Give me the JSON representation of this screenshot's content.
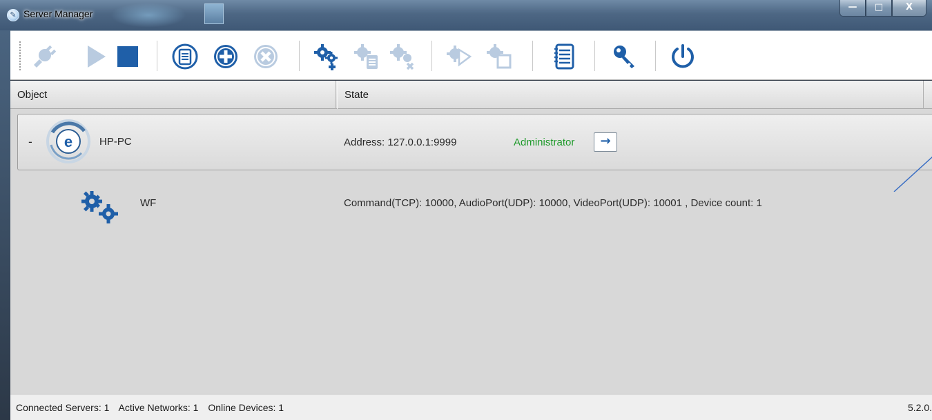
{
  "window": {
    "title": "Server Manager",
    "caption_buttons": {
      "minimize": "—",
      "maximize": "□",
      "close": "X"
    }
  },
  "toolbar": {
    "buttons": [
      {
        "name": "connect",
        "icon": "plug-connect-icon",
        "enabled": false
      },
      {
        "name": "start",
        "icon": "play-icon",
        "enabled": false
      },
      {
        "name": "stop",
        "icon": "stop-icon",
        "enabled": true
      },
      {
        "name": "server-properties",
        "icon": "circle-list-icon",
        "enabled": true
      },
      {
        "name": "add-server",
        "icon": "circle-plus-icon",
        "enabled": true
      },
      {
        "name": "remove-server",
        "icon": "circle-x-icon",
        "enabled": false
      },
      {
        "name": "add-network",
        "icon": "gears-plus-icon",
        "enabled": true
      },
      {
        "name": "network-properties",
        "icon": "gears-list-icon",
        "enabled": false
      },
      {
        "name": "remove-network",
        "icon": "gears-x-icon",
        "enabled": false
      },
      {
        "name": "start-network",
        "icon": "gear-play-icon",
        "enabled": false
      },
      {
        "name": "network-settings",
        "icon": "gear-window-icon",
        "enabled": false
      },
      {
        "name": "log",
        "icon": "log-list-icon",
        "enabled": true
      },
      {
        "name": "license",
        "icon": "key-icon",
        "enabled": true
      },
      {
        "name": "exit",
        "icon": "power-icon",
        "enabled": true
      }
    ],
    "colors": {
      "active": "#1f5fa8",
      "disabled": "#b9cbe0"
    }
  },
  "columns": {
    "object": "Object",
    "state": "State"
  },
  "server": {
    "toggle": "-",
    "name": "HP-PC",
    "address": "Address: 127.0.0.1:9999",
    "role": "Administrator",
    "role_color": "#1e9a2a",
    "goto_label": "→"
  },
  "network": {
    "name": "WF",
    "state": "Command(TCP): 10000, AudioPort(UDP): 10000, VideoPort(UDP): 10001 , Device count: 1"
  },
  "status": {
    "connected_servers": "Connected Servers: 1",
    "active_networks": "Active Networks: 1",
    "online_devices": "Online Devices: 1",
    "version": "5.2.0."
  }
}
